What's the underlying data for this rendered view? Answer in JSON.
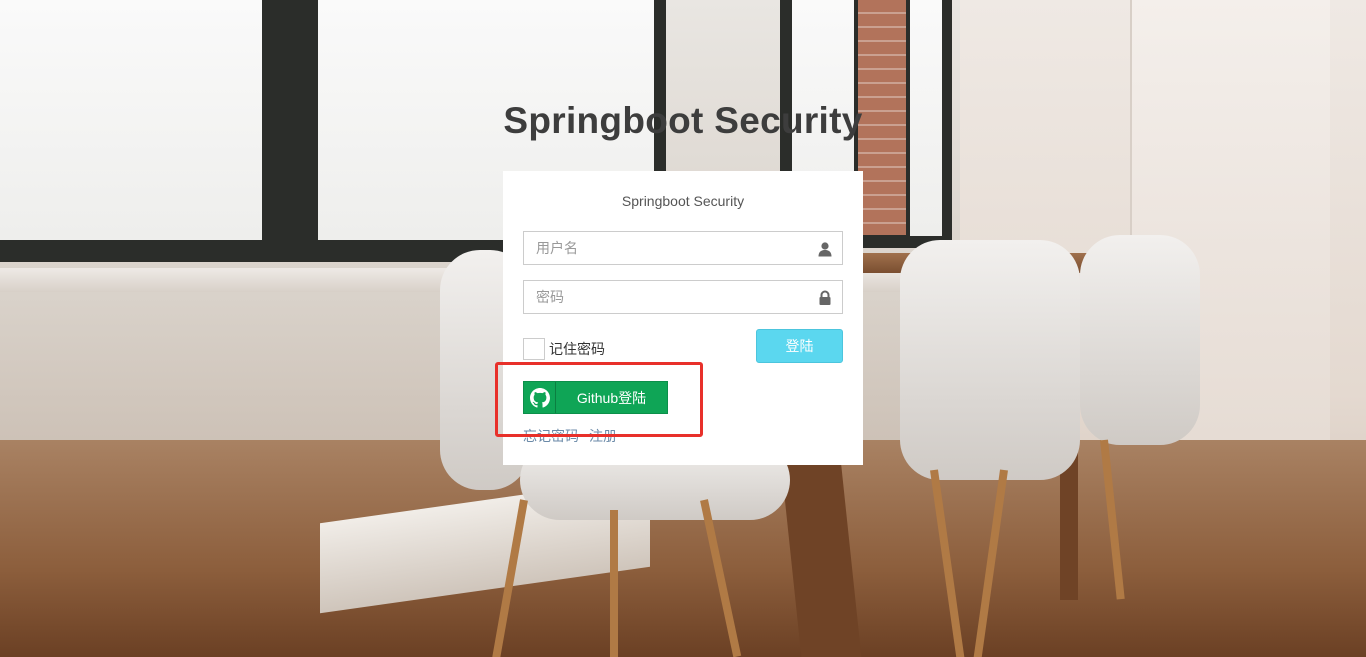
{
  "page": {
    "heading": "Springboot Security"
  },
  "login_panel": {
    "title": "Springboot Security",
    "username": {
      "placeholder": "用户名",
      "value": "",
      "icon": "user-icon"
    },
    "password": {
      "placeholder": "密码",
      "value": "",
      "icon": "lock-icon"
    },
    "remember_label": "记住密码",
    "remember_checked": false,
    "login_button": "登陆",
    "github_button": "Github登陆",
    "github_icon": "github-icon",
    "forgot_link": "忘记密码",
    "register_link": "注册"
  },
  "colors": {
    "login_button": "#5bd7ef",
    "github_button": "#0fa556",
    "link": "#6b8aa8",
    "highlight_box": "#e8302a"
  }
}
